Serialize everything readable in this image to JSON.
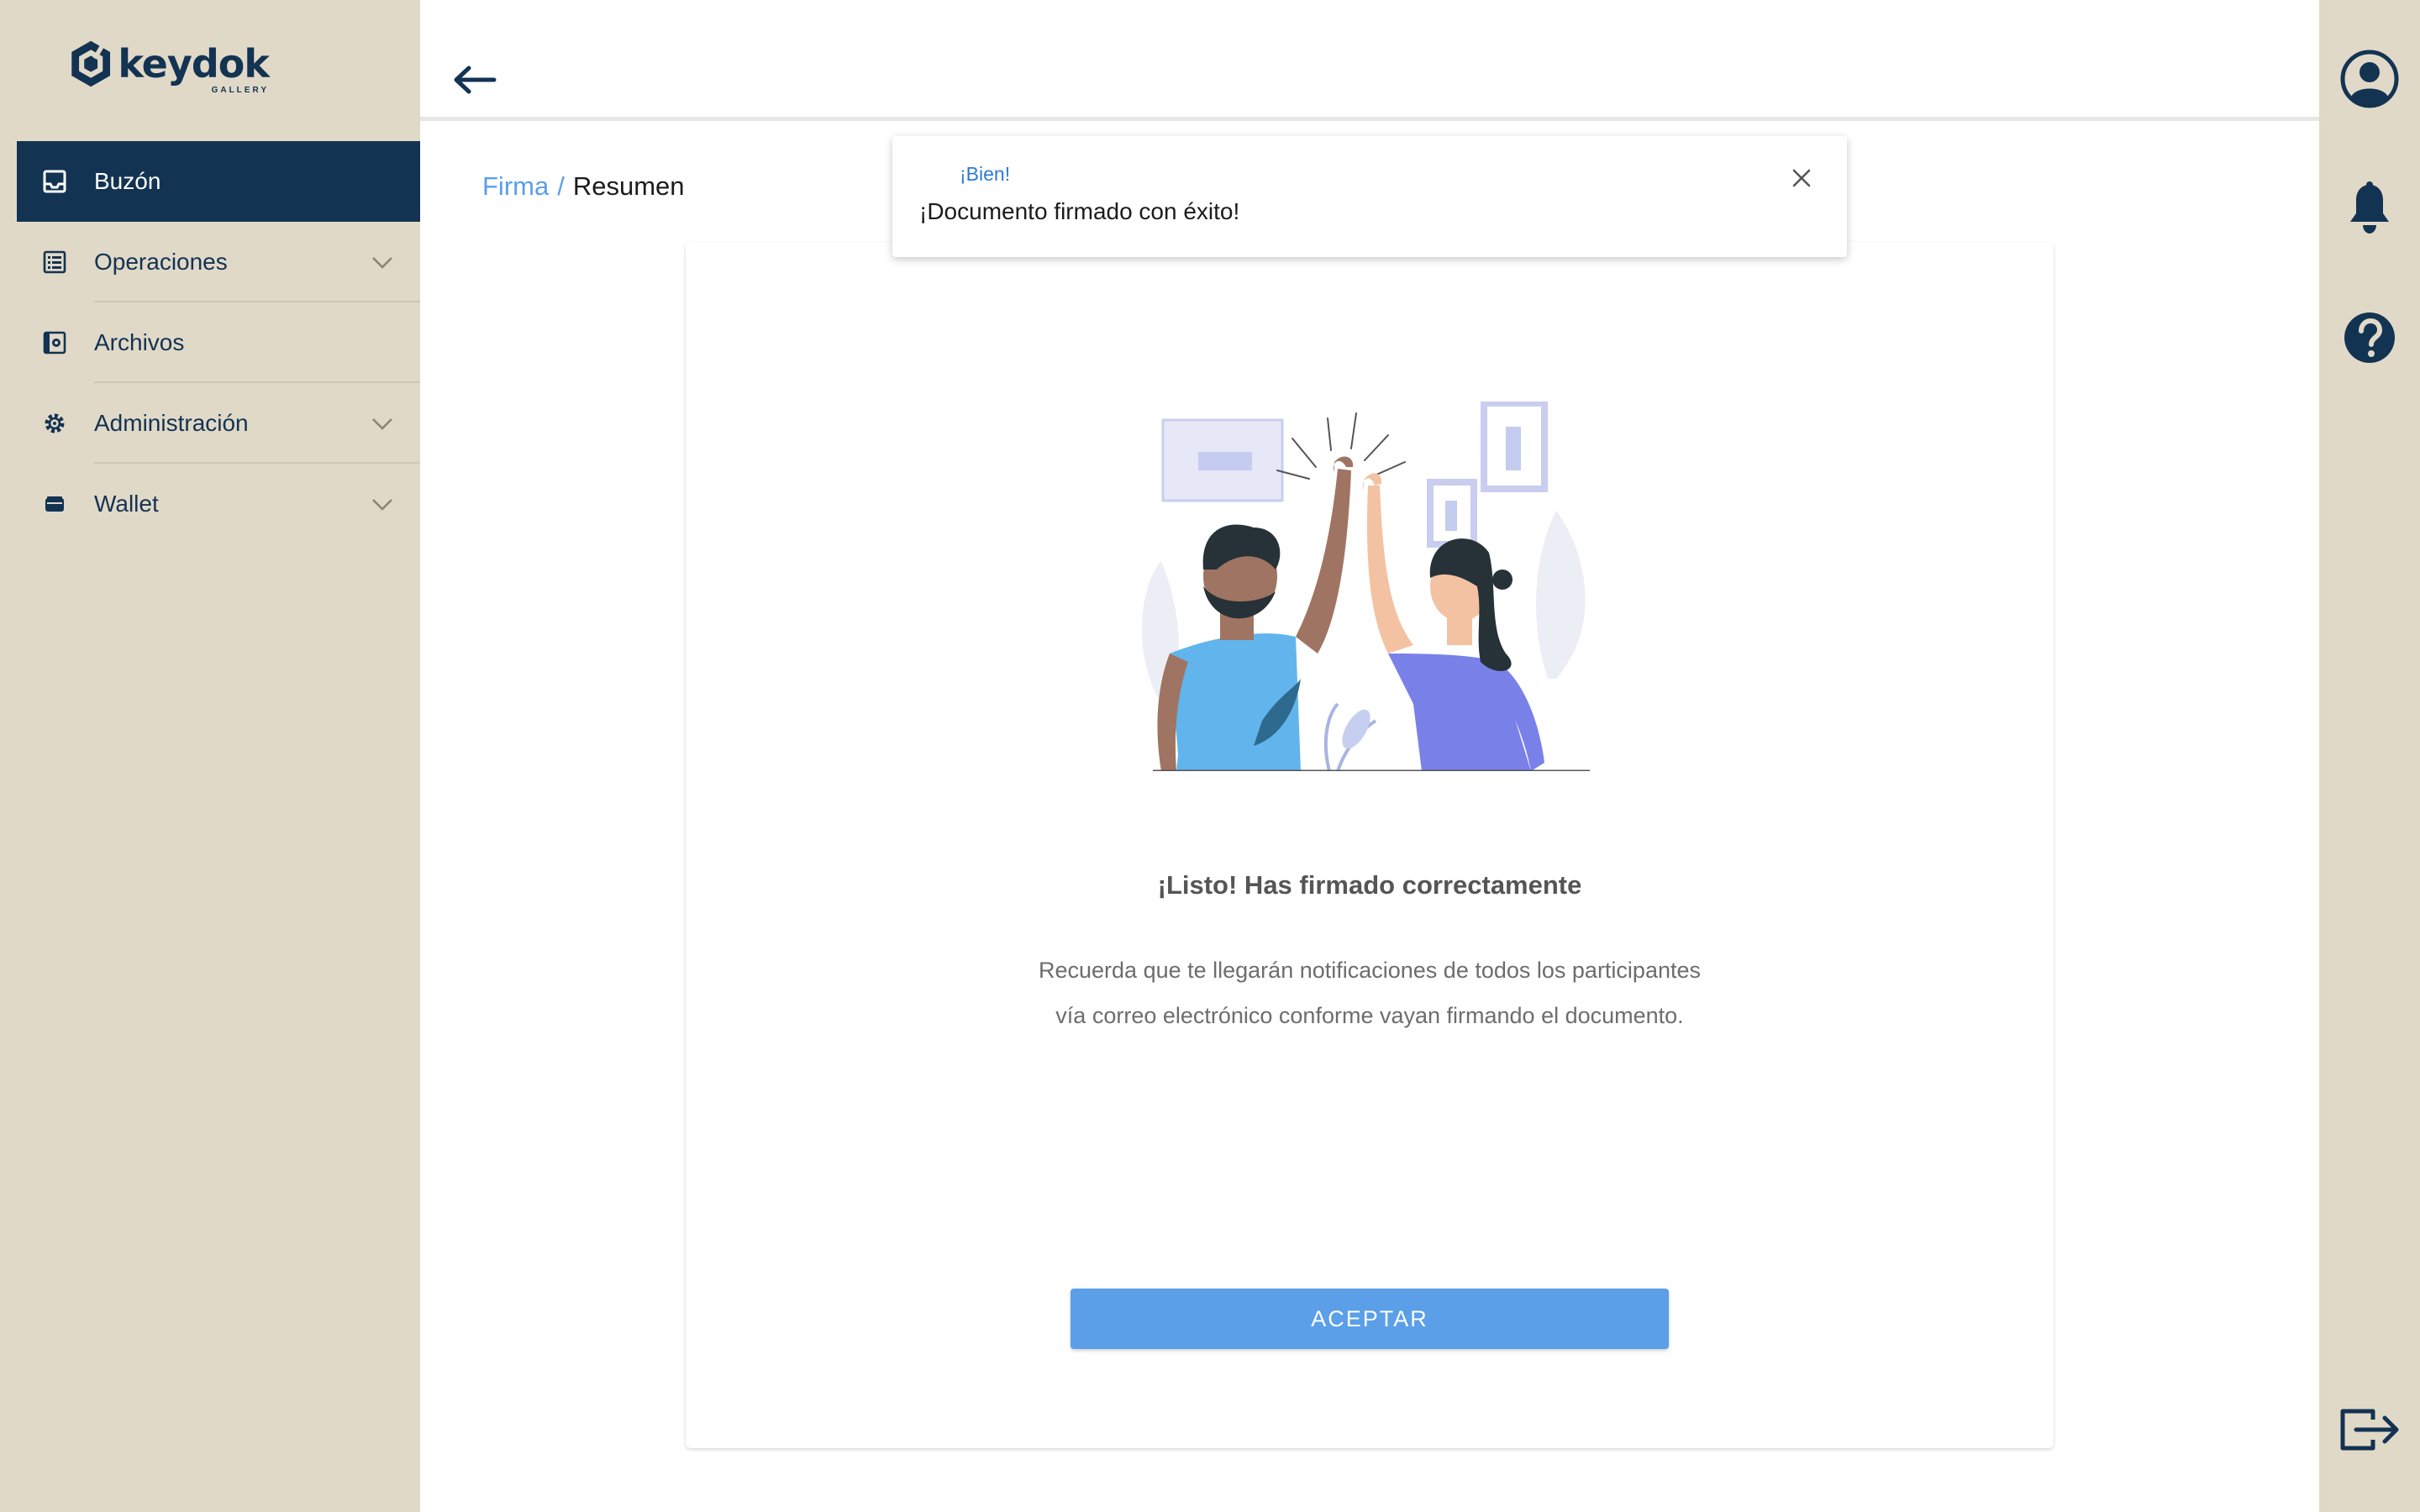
{
  "brand": {
    "name": "keydok",
    "subtitle": "GALLERY"
  },
  "sidebar": {
    "items": [
      {
        "label": "Buzón",
        "icon": "inbox-icon",
        "active": true,
        "expandable": false
      },
      {
        "label": "Operaciones",
        "icon": "list-icon",
        "active": false,
        "expandable": true
      },
      {
        "label": "Archivos",
        "icon": "archive-icon",
        "active": false,
        "expandable": false
      },
      {
        "label": "Administración",
        "icon": "gear-icon",
        "active": false,
        "expandable": true
      },
      {
        "label": "Wallet",
        "icon": "wallet-icon",
        "active": false,
        "expandable": true
      }
    ]
  },
  "rail": {
    "icons": [
      "user-icon",
      "bell-icon",
      "help-icon",
      "logout-icon"
    ]
  },
  "breadcrumb": {
    "parent": "Firma",
    "separator": "/",
    "current": "Resumen"
  },
  "toast": {
    "title": "¡Bien!",
    "message": "¡Documento firmado con éxito!"
  },
  "card": {
    "title": "¡Listo! Has firmado correctamente",
    "text": "Recuerda que te llegarán notificaciones de todos los participantes vía correo electrónico conforme vayan firmando el documento.",
    "button": "ACEPTAR"
  },
  "colors": {
    "sidebar_bg": "#e1d9c8",
    "navy": "#133352",
    "accent": "#5a9fe8"
  }
}
